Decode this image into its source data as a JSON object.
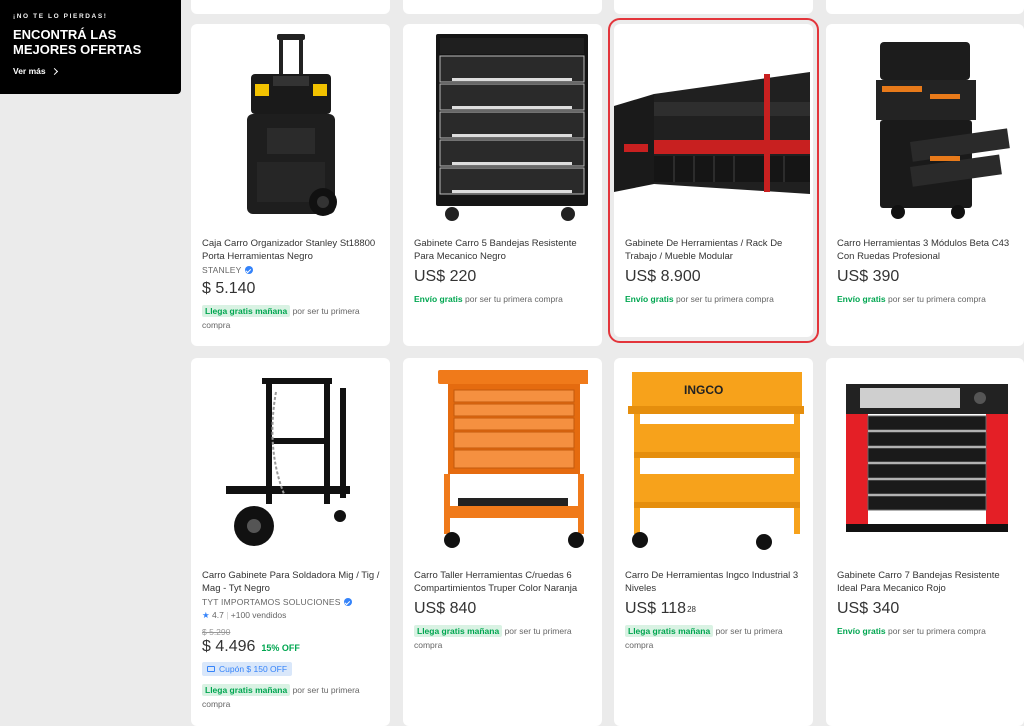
{
  "promo": {
    "kicker": "¡NO TE LO PIERDAS!",
    "title": "ENCONTRÁ LAS MEJORES OFERTAS",
    "link": "Ver más"
  },
  "colors": {
    "accent": "#3483fa",
    "green": "#00a650",
    "highlight": "#e3353b"
  },
  "products": [
    {
      "title": "Caja Carro Organizador Stanley St18800 Porta Herramientas Negro",
      "seller": "STANLEY",
      "price": "$ 5.140",
      "ship_tag": "Llega gratis mañana",
      "ship_rest": "por ser tu primera compra"
    },
    {
      "title": "Gabinete Carro 5 Bandejas Resistente Para Mecanico Negro",
      "price": "US$ 220",
      "ship_tag": "Envío gratis",
      "ship_rest": "por ser tu primera compra"
    },
    {
      "title": "Gabinete De Herramientas / Rack De Trabajo / Mueble Modular",
      "price": "US$ 8.900",
      "ship_tag": "Envío gratis",
      "ship_rest": "por ser tu primera compra"
    },
    {
      "title": "Carro Herramientas 3 Módulos Beta C43 Con Ruedas Profesional",
      "price": "US$ 390",
      "ship_tag": "Envío gratis",
      "ship_rest": "por ser tu primera compra"
    },
    {
      "title": "Carro Gabinete Para Soldadora Mig / Tig / Mag - Tyt Negro",
      "seller": "TYT IMPORTAMOS SOLUCIONES",
      "rating": "4.7",
      "sold": "+100 vendidos",
      "old_price": "$ 5.290",
      "price": "$ 4.496",
      "discount": "15% OFF",
      "coupon": "Cupón $ 150 OFF",
      "ship_tag": "Llega gratis mañana",
      "ship_rest": "por ser tu primera compra"
    },
    {
      "title": "Carro Taller Herramientas C/ruedas 6 Compartimientos Truper Color Naranja",
      "price": "US$ 840",
      "ship_tag": "Llega gratis mañana",
      "ship_rest": "por ser tu primera compra"
    },
    {
      "title": "Carro De Herramientas Ingco Industrial 3 Niveles",
      "price": "US$ 118",
      "price_cents": "28",
      "ship_tag": "Llega gratis mañana",
      "ship_rest": "por ser tu primera compra",
      "brand_text": "INGCO"
    },
    {
      "title": "Gabinete Carro 7 Bandejas Resistente Ideal Para Mecanico Rojo",
      "price": "US$ 340",
      "ship_tag": "Envío gratis",
      "ship_rest": "por ser tu primera compra"
    }
  ]
}
